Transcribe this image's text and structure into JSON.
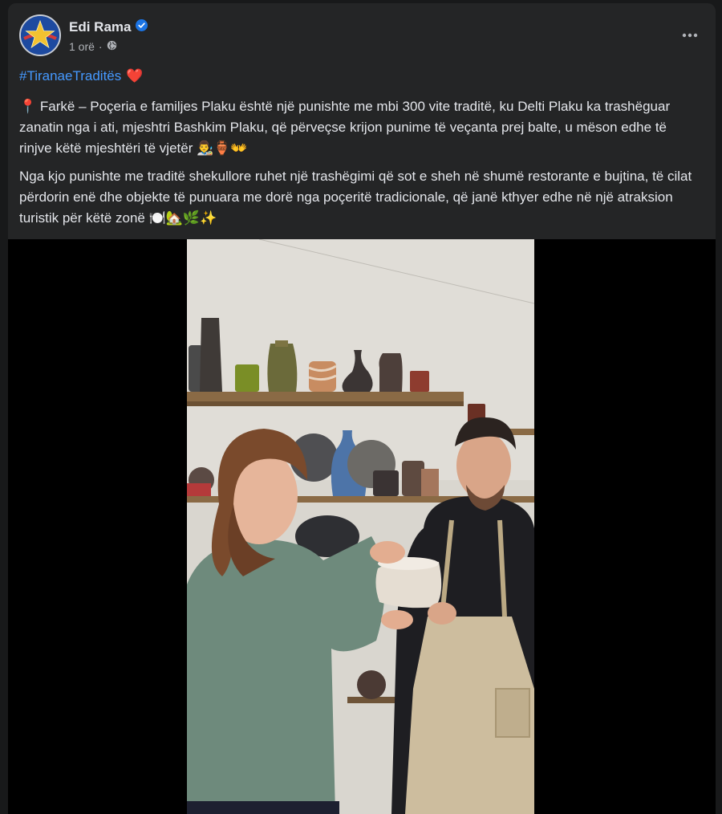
{
  "post": {
    "author": "Edi Rama",
    "time": "1 orë",
    "visibility_icon": "globe-icon",
    "hashtag": "#TiranaeTraditës",
    "hashtag_emoji": "❤️",
    "paragraph1": "📍 Farkë – Poçeria e familjes Plaku është një punishte me mbi 300 vite traditë, ku Delti Plaku ka trashëguar zanatin nga i ati, mjeshtri Bashkim Plaku, që përveçse krijon punime të veçanta prej balte, u mëson edhe të rinjve këtë mjeshtëri të vjetër 👨‍🎨🏺👐",
    "paragraph2": "Nga kjo punishte me traditë shekullore ruhet një trashëgimi që sot e sheh në shumë restorante e bujtina, të cilat përdorin enë dhe objekte të punuara me dorë nga poçeritë tradicionale, që janë kthyer edhe në një atraksion turistik për këtë zonë 🍽️🏡🌿✨"
  },
  "colors": {
    "card": "#242526",
    "page": "#18191a",
    "text": "#e4e6eb",
    "secondary": "#b0b3b8",
    "link": "#4599ff",
    "verified": "#1b74e4"
  }
}
